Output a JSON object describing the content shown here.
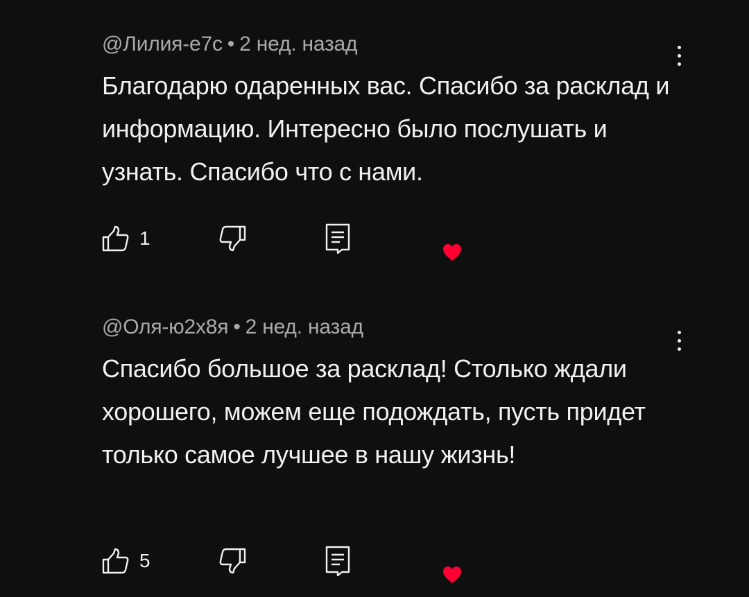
{
  "comments": [
    {
      "author": "@Лилия-е7с",
      "separator": "•",
      "time": "2 нед. назад",
      "text": "Благодарю одаренных вас. Спасибо за расклад и информацию. Интересно было послушать и узнать. Спасибо что с нами.",
      "likes": "1",
      "hearted": true
    },
    {
      "author": "@Оля-ю2х8я",
      "separator": "•",
      "time": "2 нед. назад",
      "text": "Спасибо большое за расклад! Столько ждали хорошего, можем еще подождать, пусть придет только самое лучшее в нашу жизнь!",
      "likes": "5",
      "hearted": true
    }
  ],
  "colors": {
    "background": "#0f0f0f",
    "text": "#f1f1f1",
    "meta": "#aaaaaa",
    "heart": "#ff0033"
  },
  "icons": [
    "like-icon",
    "dislike-icon",
    "reply-icon",
    "heart-icon",
    "more-vert-icon"
  ]
}
